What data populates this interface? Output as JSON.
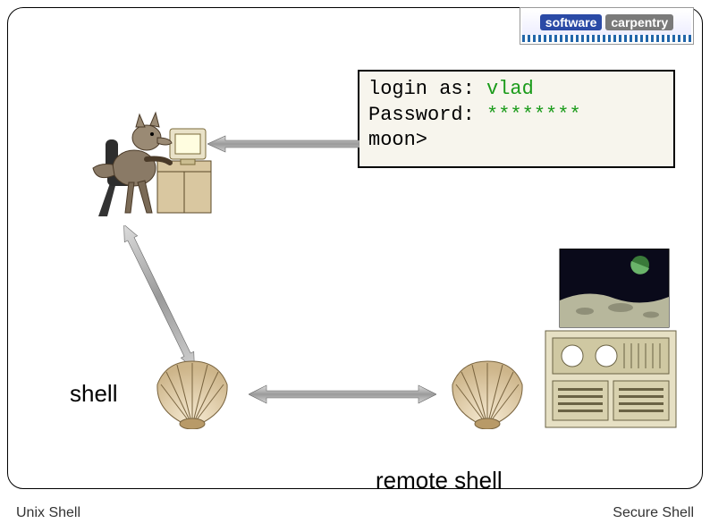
{
  "logo": {
    "part1": "software",
    "part2": "carpentry"
  },
  "terminal": {
    "login_label": "login as: ",
    "login_value": "vlad",
    "password_label": "Password: ",
    "password_value": "********",
    "prompt": "moon>"
  },
  "labels": {
    "shell": "shell",
    "remote_shell": "remote shell"
  },
  "footer": {
    "left": "Unix Shell",
    "right": "Secure Shell"
  }
}
